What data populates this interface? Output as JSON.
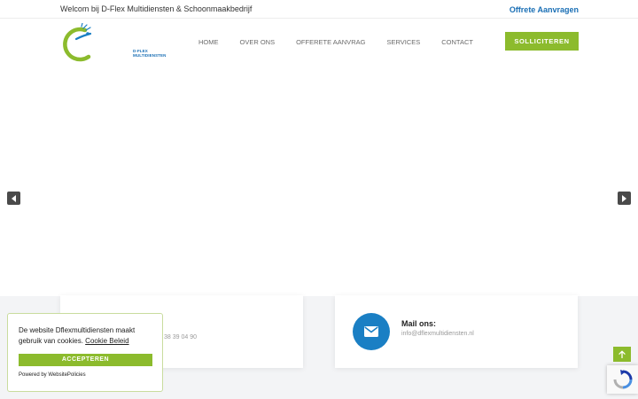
{
  "topbar": {
    "welcome_text": "Welcom bij D-Flex Multidiensten & Schoonmaakbedrijf",
    "offer_link": "Offrete Aanvragen"
  },
  "header": {
    "logo_text": "D-FLEX MULTIDIENSTEN",
    "nav": [
      "HOME",
      "OVER ONS",
      "OFFERETE AANVRAG",
      "SERVICES",
      "CONTACT"
    ],
    "apply_button": "SOLLICITEREN"
  },
  "slider": {
    "prev_icon": "caret-left-icon",
    "next_icon": "caret-right-icon"
  },
  "contact": {
    "phone_partial": "38 39 04 90",
    "mail_title": "Mail ons:",
    "mail_value": "info@dflexmultidiensten.nl"
  },
  "cookie": {
    "message": "De website Dflexmultidiensten maakt gebruik van cookies.",
    "policy_link": "Cookie Beleid",
    "accept_button": "ACCEPTEREN",
    "powered_by": "Powered by WebsitePolicies"
  },
  "colors": {
    "accent_green": "#8cbb2d",
    "brand_blue": "#1a7fc4",
    "link_blue": "#1a6fb5"
  }
}
